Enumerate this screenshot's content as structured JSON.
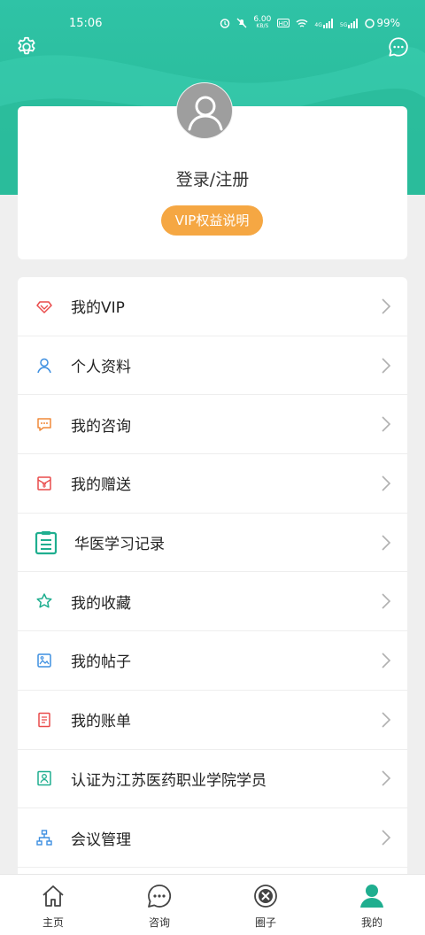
{
  "status_bar": {
    "time": "15:06",
    "net_speed": "6.00",
    "net_unit": "KB/S",
    "signal_tag1": "4G",
    "signal_tag2": "5G",
    "battery": "99%"
  },
  "header": {
    "settings_icon": "gear-icon",
    "message_icon": "chat-bubble-icon",
    "accent": "#2fc3a6"
  },
  "profile": {
    "login_label": "登录/注册",
    "vip_label": "VIP权益说明",
    "vip_color": "#f5a743"
  },
  "menu": {
    "items": [
      {
        "label": "我的VIP",
        "icon": "diamond-icon"
      },
      {
        "label": "个人资料",
        "icon": "person-icon"
      },
      {
        "label": "我的咨询",
        "icon": "chat-icon"
      },
      {
        "label": "我的赠送",
        "icon": "gift-envelope-icon"
      },
      {
        "label": "华医学习记录",
        "icon": "clipboard-list-icon"
      },
      {
        "label": "我的收藏",
        "icon": "star-icon"
      },
      {
        "label": "我的帖子",
        "icon": "image-post-icon"
      },
      {
        "label": "我的账单",
        "icon": "bill-icon"
      },
      {
        "label": "认证为江苏医药职业学院学员",
        "icon": "certificate-icon"
      },
      {
        "label": "会议管理",
        "icon": "org-chart-icon"
      }
    ]
  },
  "tabbar": {
    "tabs": [
      {
        "label": "主页",
        "icon": "home-icon",
        "active": false
      },
      {
        "label": "咨询",
        "icon": "chat-icon",
        "active": false
      },
      {
        "label": "圈子",
        "icon": "circle-icon",
        "active": false
      },
      {
        "label": "我的",
        "icon": "person-icon",
        "active": true
      }
    ]
  }
}
